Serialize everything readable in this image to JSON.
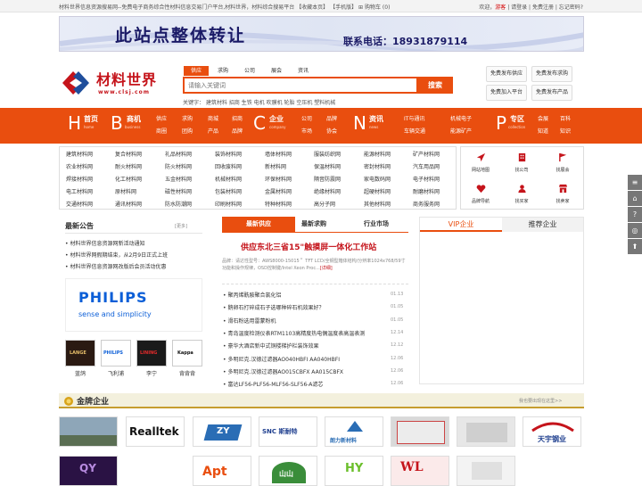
{
  "topbar": {
    "left_text": "材料世界信息资源搜易网--免费电子商务综合性材料信息交易门户平台,材料世界，材料综合搜易平台",
    "links": [
      "【收藏本页】",
      "【手机版】",
      "购物车 (0)"
    ],
    "welcome": "欢迎，",
    "guest": "游客",
    "auth": "| 请登录 | 免费注册 | 忘记密码?"
  },
  "banner": {
    "title": "此站点整体转让",
    "phone": "联系电话：18931879114"
  },
  "logo": {
    "title": "材料世界",
    "url": "www.clsj.com"
  },
  "search": {
    "tabs": [
      "供应",
      "求购",
      "公司",
      "展会",
      "资讯"
    ],
    "placeholder": "请输入关键词",
    "button": "搜索",
    "hot_label": "关键字：",
    "hot_words": "建筑材料  招商  生铁  电机  吹膜机  轮胎  空压机  塑料机械"
  },
  "quick": [
    "免费发布供应",
    "免费发布求购",
    "免费加入平台",
    "免费发布产品"
  ],
  "nav": {
    "main": [
      {
        "letter": "H",
        "title": "首页",
        "en": "home"
      },
      {
        "letter": "B",
        "title": "商机",
        "en": "business"
      },
      {
        "letter": "C",
        "title": "企业",
        "en": "company"
      },
      {
        "letter": "N",
        "title": "资讯",
        "en": "news"
      },
      {
        "letter": "P",
        "title": "专区",
        "en": "collection"
      }
    ],
    "groups": [
      [
        "供应",
        "求购",
        "商城",
        "招商"
      ],
      [
        "商圈",
        "团购",
        "产品",
        "品牌"
      ],
      [
        "公司",
        "品牌"
      ],
      [
        "市场",
        "协会"
      ],
      [
        "IT与通讯",
        "机械电子"
      ],
      [
        "车辆交通",
        "能源矿产"
      ],
      [
        "会展",
        "百科"
      ],
      [
        "知道",
        "知识"
      ]
    ]
  },
  "categories": [
    [
      "建筑材料网",
      "复合材料网",
      "礼品材料网",
      "装饰材料网",
      "墙体材料网",
      "服装纺织网",
      "能源材料网",
      "矿产材料网"
    ],
    [
      "农业材料网",
      "耐火材料网",
      "防火材料网",
      "回收废料网",
      "新材料网",
      "保温材料网",
      "密封材料网",
      "汽车用品网"
    ],
    [
      "焊接材料网",
      "化工材料网",
      "五金材料网",
      "机械材料网",
      "环保材料网",
      "隔音防震网",
      "家电数码网",
      "电子材料网"
    ],
    [
      "电工材料网",
      "原材料网",
      "磁性材料网",
      "包装材料网",
      "金属材料网",
      "绝缘材料网",
      "超硬材料网",
      "耐磨材料网"
    ],
    [
      "交通材料网",
      "通讯材料网",
      "防水防潮网",
      "印刷材料网",
      "特种材料网",
      "高分子网",
      "其他材料网",
      "商务服务网"
    ]
  ],
  "icon_grid": [
    {
      "label": "网站地图",
      "icon": "navigate-icon"
    },
    {
      "label": "找公司",
      "icon": "building-icon"
    },
    {
      "label": "找展会",
      "icon": "flag-icon"
    },
    {
      "label": "品牌导航",
      "icon": "heart-icon"
    },
    {
      "label": "找买家",
      "icon": "user-icon"
    },
    {
      "label": "找卖家",
      "icon": "shop-icon"
    }
  ],
  "announcements": {
    "title": "最新公告",
    "more": "[更多]",
    "items": [
      "材料世界信息资源网新活动通知",
      "材料世界网假期结束，从2月9日正式上班",
      "材料世界信息资源网改版后会员活动优惠"
    ]
  },
  "brand_ad": {
    "name": "PHILIPS",
    "slogan": "sense and simplicity"
  },
  "brands": [
    {
      "label": "蓝鸽",
      "logo_text": "LANGE"
    },
    {
      "label": "飞利浦",
      "logo_text": "PHILIPS"
    },
    {
      "label": "李宁",
      "logo_text": "LINING"
    },
    {
      "label": "背背背",
      "logo_text": "Kappa"
    }
  ],
  "center": {
    "tabs": [
      "最新供应",
      "最新求购",
      "行业市场"
    ],
    "feature_title": "供应东北三省15\"触摸屏一体化工作站",
    "feature_desc": "品牌：请达性型号：AWS8000-15015＂ TFT LCD/全钢型箱体结构/分辨率1024x768/59寸功能和操作规律，OSD控制键/Intel Xeon Proc...",
    "feature_link": "[详细]",
    "news": [
      {
        "title": "聚丙烯酰胺聚合氯化铝",
        "date": "01.13"
      },
      {
        "title": "鹅卵石打碎成石子选哪种碎石机效果好？",
        "date": "01.05"
      },
      {
        "title": "滑石粉选用雷蒙粉机",
        "date": "01.05"
      },
      {
        "title": "青岛温度检测仪表RTM1103高精度热电偶温度表高温表测",
        "date": "12.14"
      },
      {
        "title": "豪华大酒店新中式铜楼梯护栏装饰效果",
        "date": "12.12"
      },
      {
        "title": "多明尼克.汉德过滤器AO040HBFI AA040HBFI",
        "date": "12.06"
      },
      {
        "title": "多明尼克.汉德过滤器AO015CBFX AA015CBFX",
        "date": "12.06"
      },
      {
        "title": "富达LF56-PLF56-MLF56-SLF56-A滤芯",
        "date": "12.06"
      }
    ]
  },
  "vip": {
    "tabs": [
      "VIP企业",
      "推荐企业"
    ]
  },
  "side_tools": [
    "≡",
    "⌂",
    "?",
    "◎",
    "⬆"
  ],
  "gold": {
    "title": "金牌企业",
    "more": "我也要出现在这里>>",
    "logos": [
      "",
      "Realltek",
      "ZY",
      "SNC 斯耐特",
      "朗力新材料",
      "",
      "",
      "天宇钢业",
      "QY",
      "Apt",
      "山山",
      "HY",
      "WL",
      ""
    ]
  }
}
